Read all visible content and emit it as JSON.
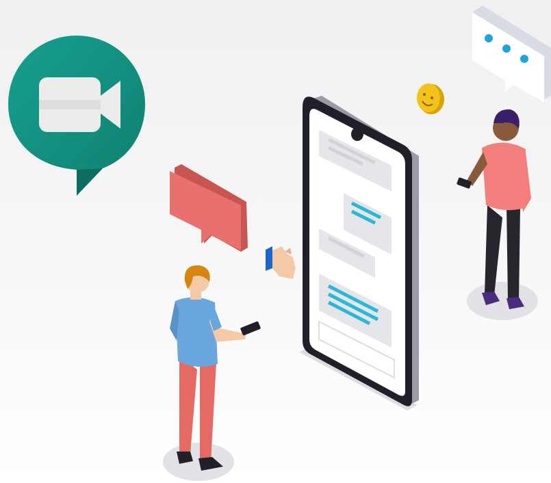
{
  "scene": {
    "logo": {
      "icon": "video-camera-icon",
      "bubble_color": "#128c7e",
      "camera_color": "#ececec"
    },
    "phone": {
      "frame_color": "#1f2028",
      "screen_color": "#ffffff"
    },
    "chat": {
      "received_color": "#e6e6ea",
      "sent_accent_color": "#29b8d6",
      "floating_red_bubble_color": "#e8706d",
      "floating_dots_color": "#1fa4d9"
    },
    "reactions": [
      "smiley-emoji-icon",
      "thumbs-up-icon"
    ],
    "people": [
      {
        "role": "person-left",
        "shirt": "#6aa6de",
        "pants": "#e66a64",
        "hair": "#d4860e"
      },
      {
        "role": "person-right",
        "shirt": "#f27f7b",
        "pants": "#26262c",
        "hair": "#3b1f6b"
      }
    ]
  }
}
